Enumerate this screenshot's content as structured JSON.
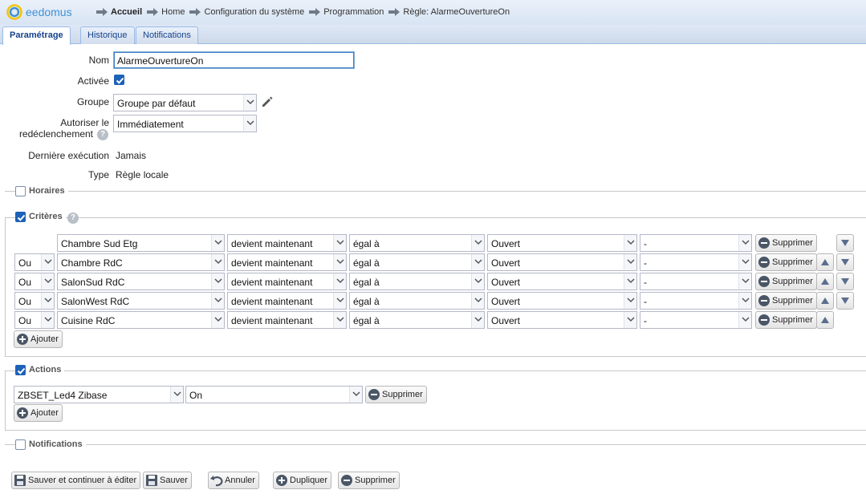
{
  "app": {
    "logo_text": "eedomus"
  },
  "breadcrumb": [
    "Accueil",
    "Home",
    "Configuration du système",
    "Programmation",
    "Règle: AlarmeOuvertureOn"
  ],
  "tabs": [
    "Paramétrage",
    "Historique",
    "Notifications"
  ],
  "form": {
    "nom_label": "Nom",
    "nom_value": "AlarmeOuvertureOn",
    "activee_label": "Activée",
    "groupe_label": "Groupe",
    "groupe_value": "Groupe par défaut",
    "autoriser_label_1": "Autoriser le",
    "autoriser_label_2": "redéclenchement",
    "autoriser_value": "Immédiatement",
    "derniere_label": "Dernière exécution",
    "derniere_value": "Jamais",
    "type_label": "Type",
    "type_value": "Règle locale"
  },
  "sections": {
    "horaires": "Horaires",
    "criteres": "Critères",
    "actions": "Actions",
    "notifications": "Notifications"
  },
  "criteria": [
    {
      "op": "",
      "device": "Chambre Sud Etg",
      "cond": "devient maintenant",
      "cmp": "égal à",
      "value": "Ouvert",
      "extra": "-"
    },
    {
      "op": "Ou",
      "device": "Chambre RdC",
      "cond": "devient maintenant",
      "cmp": "égal à",
      "value": "Ouvert",
      "extra": "-"
    },
    {
      "op": "Ou",
      "device": "SalonSud RdC",
      "cond": "devient maintenant",
      "cmp": "égal à",
      "value": "Ouvert",
      "extra": "-"
    },
    {
      "op": "Ou",
      "device": "SalonWest RdC",
      "cond": "devient maintenant",
      "cmp": "égal à",
      "value": "Ouvert",
      "extra": "-"
    },
    {
      "op": "Ou",
      "device": "Cuisine RdC",
      "cond": "devient maintenant",
      "cmp": "égal à",
      "value": "Ouvert",
      "extra": "-"
    }
  ],
  "actions": [
    {
      "device": "ZBSET_Led4 Zibase",
      "value": "On"
    }
  ],
  "labels": {
    "supprimer": "Supprimer",
    "ajouter": "Ajouter"
  },
  "footer": {
    "save_continue": "Sauver et continuer à éditer",
    "save": "Sauver",
    "cancel": "Annuler",
    "duplicate": "Dupliquer",
    "delete": "Supprimer"
  },
  "colors": {
    "accent": "#1d62b8",
    "tab_text": "#15428b",
    "logo": "#3f91d5"
  }
}
